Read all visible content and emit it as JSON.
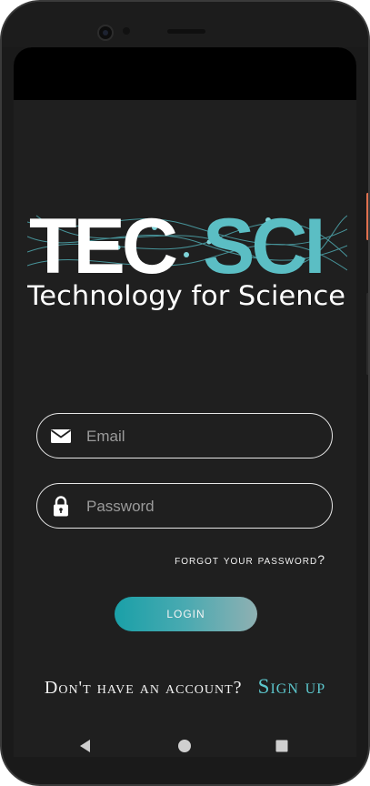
{
  "logo": {
    "brand_primary": "TEC",
    "brand_secondary": "SCI",
    "tagline": "Technology for Science",
    "primary_color": "#ffffff",
    "accent_color": "#5bbec4"
  },
  "form": {
    "email_placeholder": "Email",
    "email_value": "",
    "password_placeholder": "Password",
    "password_value": "",
    "email_icon": "envelope-icon",
    "password_icon": "lock-icon",
    "forgot_password_label": "forgot your password?",
    "login_label": "LOGIN"
  },
  "signup": {
    "prompt": "Don't have an account?",
    "link_label": "Sign up"
  },
  "navigation": {
    "back_icon": "back-triangle-icon",
    "home_icon": "home-circle-icon",
    "recents_icon": "recents-square-icon"
  },
  "colors": {
    "background": "#1f1f1f",
    "login_gradient_start": "#1aa0a8",
    "login_gradient_end": "#8fb0b2",
    "signup_link": "#5cc6cc"
  }
}
